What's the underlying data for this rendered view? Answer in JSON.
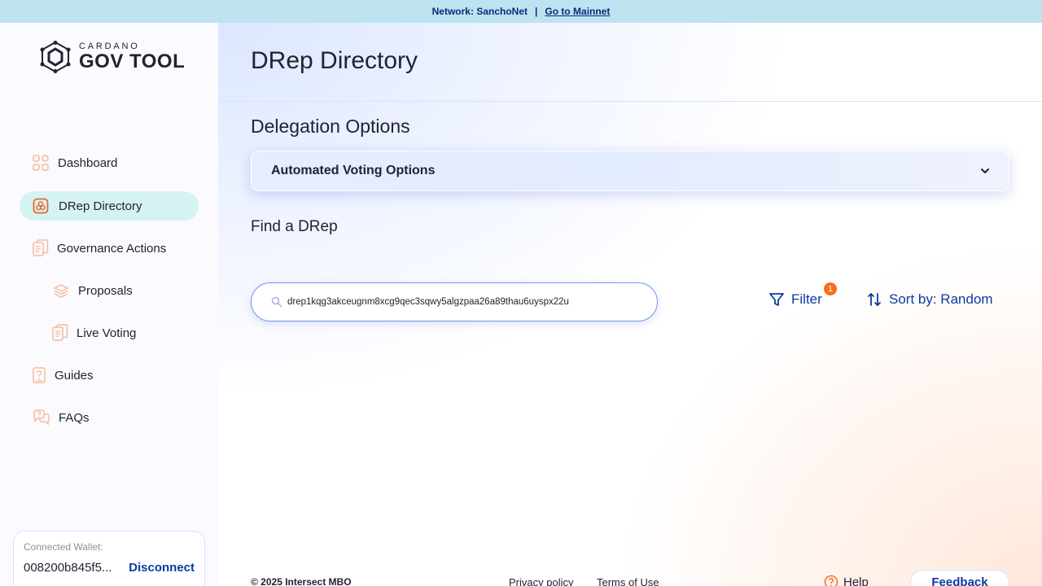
{
  "banner": {
    "network_text": "Network: SanchoNet",
    "separator": "|",
    "mainnet_link": "Go to Mainnet"
  },
  "logo": {
    "small": "CARDANO",
    "big": "GOV TOOL"
  },
  "sidebar": {
    "items": [
      {
        "label": "Dashboard",
        "icon": "dashboard-icon"
      },
      {
        "label": "DRep Directory",
        "icon": "drep-icon",
        "active": true
      },
      {
        "label": "Governance Actions",
        "icon": "documents-icon"
      },
      {
        "label": "Proposals",
        "icon": "layers-icon"
      },
      {
        "label": "Live Voting",
        "icon": "documents-icon"
      },
      {
        "label": "Guides",
        "icon": "guide-icon"
      },
      {
        "label": "FAQs",
        "icon": "faq-icon"
      }
    ]
  },
  "wallet": {
    "label": "Connected Wallet:",
    "address": "008200b845f5...",
    "disconnect": "Disconnect"
  },
  "main": {
    "page_title": "DRep Directory",
    "delegation_title": "Delegation Options",
    "accordion_label": "Automated Voting Options",
    "find_title": "Find a DRep",
    "search_value": "drep1kqg3akceugnm8xcg9qec3sqwy5algzpaa26a89thau6uyspx22u",
    "filter_label": "Filter",
    "filter_count": "1",
    "sort_label": "Sort by: Random"
  },
  "footer": {
    "copyright": "© 2025 Intersect MBO",
    "privacy": "Privacy policy",
    "terms": "Terms of Use",
    "help": "Help",
    "feedback": "Feedback"
  },
  "colors": {
    "brand_blue": "#0b3ba0",
    "accent_orange": "#f5701e",
    "active_nav_bg": "#d6f3f4",
    "banner_bg": "#bde3f1"
  }
}
